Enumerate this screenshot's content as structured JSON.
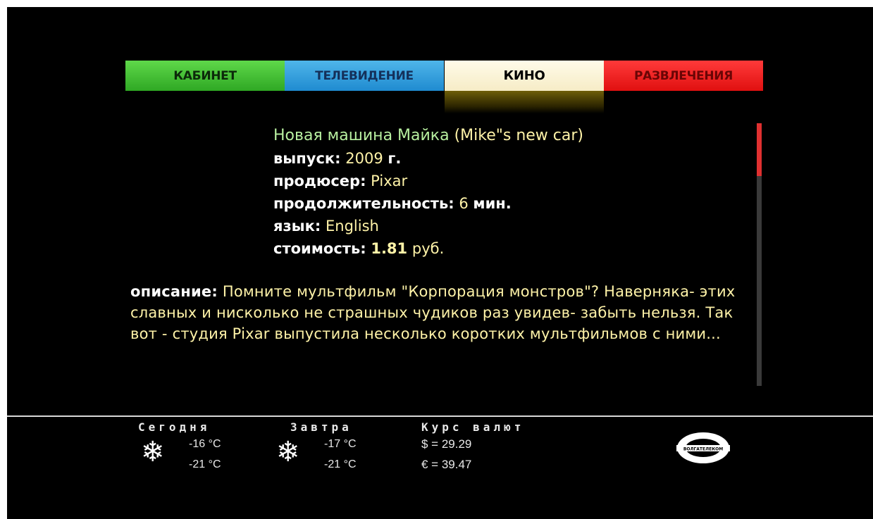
{
  "tabs": [
    {
      "label": "КАБИНЕТ",
      "color": "#3cc12e"
    },
    {
      "label": "ТЕЛЕВИДЕНИЕ",
      "color": "#2a9ad9"
    },
    {
      "label": "КИНО",
      "color": "#fbf3d6"
    },
    {
      "label": "РАЗВЛЕЧЕНИЯ",
      "color": "#f01818"
    }
  ],
  "active_tab": "КИНО",
  "movie": {
    "title_ru": "Новая машина Майка",
    "title_en": "(Mike\"s new car)",
    "release_label": "выпуск:",
    "release_value": "2009",
    "release_suffix": "г.",
    "producer_label": "продюсер:",
    "producer_value": "Pixar",
    "duration_label": "продолжительность:",
    "duration_value": "6",
    "duration_unit": "мин.",
    "language_label": "язык:",
    "language_value": "English",
    "price_label": "стоимость:",
    "price_value": "1.81",
    "price_unit": "руб."
  },
  "description": {
    "label": "описание:",
    "text": "Помните мультфильм \"Корпорация монстров\"? Наверняка- этих славных и нисколько не страшных чудиков раз увидев- забыть нельзя. Так вот - студия Pixar выпустила несколько коротких мультфильмов с ними..."
  },
  "scroll": {
    "position_fraction": 0.0,
    "visible_fraction": 0.2
  },
  "weather": {
    "today_label": "Сегодня",
    "today_high": "-16 °C",
    "today_low": "-21 °C",
    "today_icon": "snowflake-icon",
    "tomorrow_label": "Завтра",
    "tomorrow_high": "-17 °C",
    "tomorrow_low": "-21 °C",
    "tomorrow_icon": "snowflake-icon"
  },
  "currency": {
    "label": "Курс валют",
    "usd": "$ = 29.29",
    "eur": "€ = 39.47"
  },
  "logo": {
    "name": "volgatelecom-logo-icon",
    "text": "ВОЛГАТЕЛЕКОМ"
  }
}
